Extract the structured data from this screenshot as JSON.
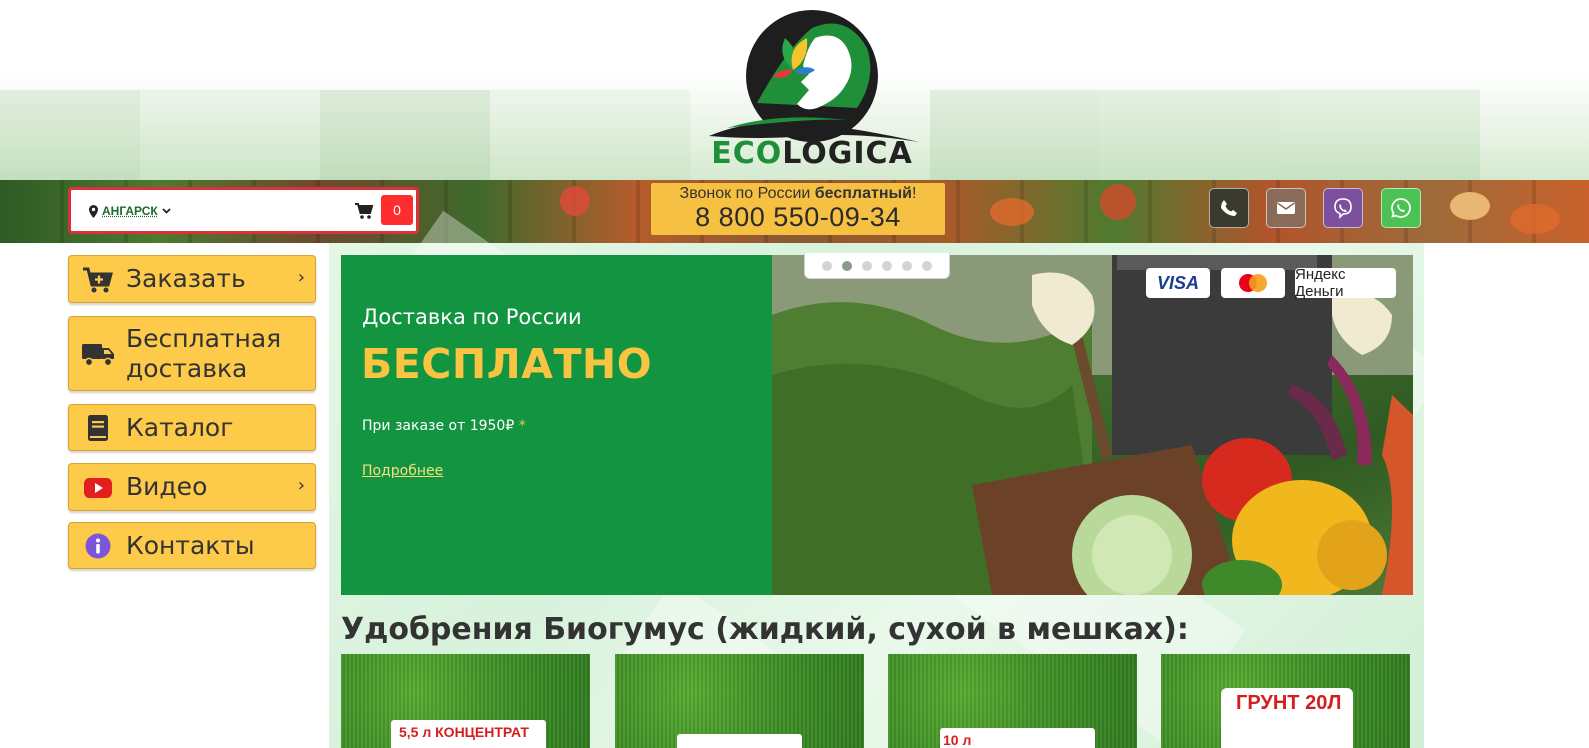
{
  "brand": {
    "logo_part1": "ECO",
    "logo_part2": "LOGICA"
  },
  "header": {
    "city": "АНГАРСК",
    "cart_count": "0",
    "phone_prefix": "Звонок по России ",
    "phone_bold": "бесплатный",
    "phone_suffix": "!",
    "phone_number": "8 800 550-09-34",
    "contact_icons": [
      "phone-icon",
      "mail-icon",
      "viber-icon",
      "whatsapp-icon"
    ]
  },
  "sidebar": {
    "items": [
      {
        "label": "Заказать",
        "icon": "cart-plus-icon",
        "has_arrow": true
      },
      {
        "label": "Бесплатная доставка",
        "icon": "truck-icon",
        "has_arrow": false
      },
      {
        "label": "Каталог",
        "icon": "book-icon",
        "has_arrow": false
      },
      {
        "label": "Видео",
        "icon": "youtube-icon",
        "has_arrow": true
      },
      {
        "label": "Контакты",
        "icon": "info-icon",
        "has_arrow": false
      }
    ]
  },
  "slider": {
    "subtitle": "Доставка по России",
    "title": "БЕСПЛАТНО",
    "note": "При заказе от 1950₽ ",
    "note_star": "*",
    "link": "Подробнее",
    "dots_count": 6,
    "active_dot": 2,
    "payment": {
      "visa": "VISA",
      "mastercard": "MasterCard",
      "yandex": "Яндекс Деньги"
    }
  },
  "products_section": {
    "title": "Удобрения Биогумус (жидкий, сухой в мешках):",
    "cards": [
      {
        "pack_text": "5,5 л   КОНЦЕНТРАТ"
      },
      {
        "pack_text": ""
      },
      {
        "pack_text": "10 л"
      },
      {
        "pack_text": "ГРУНТ 20Л"
      }
    ]
  },
  "colors": {
    "accent_yellow": "#fdca4a",
    "slide_green": "#139441",
    "cart_red": "#ff2d2d",
    "brand_green": "#1f8f3a"
  }
}
